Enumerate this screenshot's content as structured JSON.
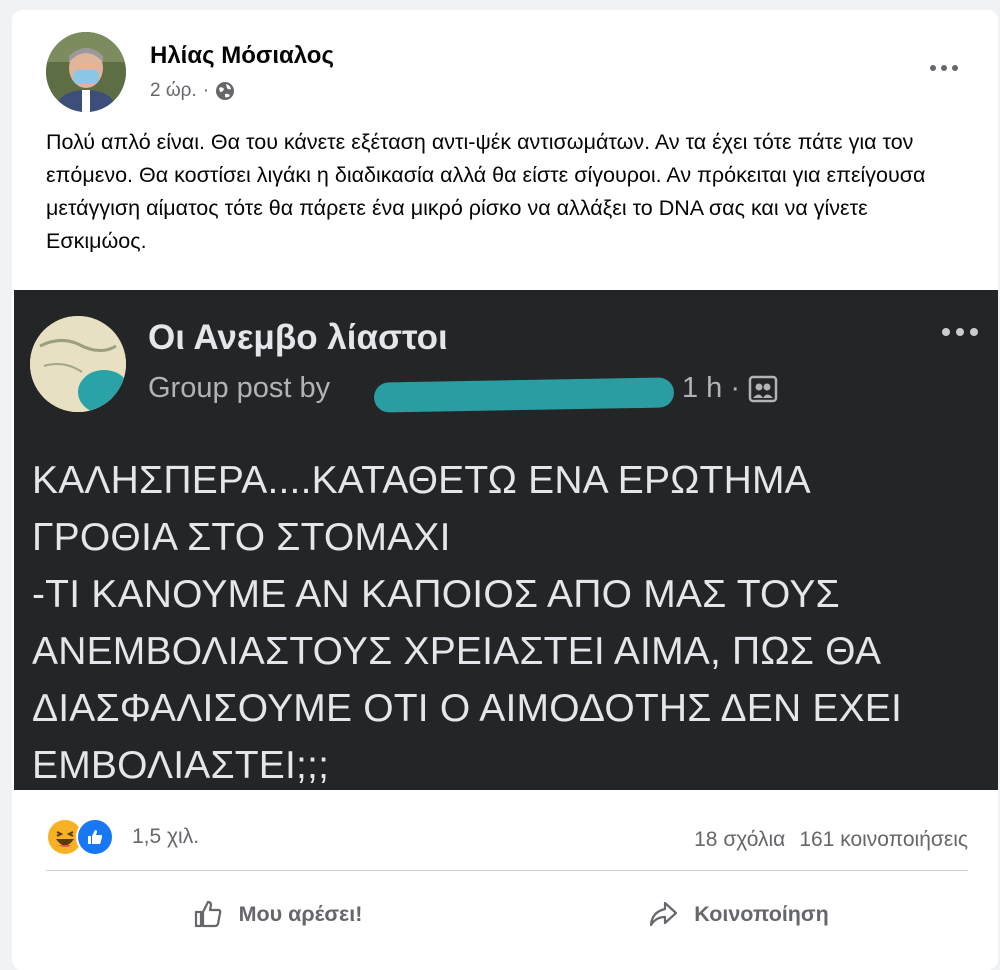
{
  "post": {
    "author": "Ηλίας Μόσιαλος",
    "time": "2 ώρ.",
    "separator": "·",
    "privacy_icon": "globe-icon",
    "more_icon": "more-options-icon",
    "text": "Πολύ απλό είναι. Θα του κάνετε εξέταση αντι-ψέκ αντισωμάτων. Αν τα έχει τότε πάτε για τον επόμενο. Θα κοστίσει λιγάκι η διαδικασία αλλά θα είστε σίγουροι. Αν πρόκειται για επείγουσα μετάγγιση αίματος τότε θα πάρετε ένα μικρό ρίσκο να αλλάξει το DNA σας και να γίνετε Εσκιμώος."
  },
  "shared": {
    "group_name": "Οι Ανεμβο λίαστοι",
    "meta_prefix": "Group post by",
    "time": "1 h ·",
    "body": "ΚΑΛΗΣΠΕΡΑ....ΚΑΤΑΘΕΤΩ ΕΝΑ ΕΡΩΤΗΜΑ\nΓΡΟΘΙΑ ΣΤΟ ΣΤΟΜΑΧΙ\n-ΤΙ ΚΑΝΟΥΜΕ ΑΝ ΚΑΠΟΙΟΣ ΑΠΟ ΜΑΣ ΤΟΥΣ\nΑΝΕΜΒΟΛΙΑΣΤΟΥΣ ΧΡΕΙΑΣΤΕΙ ΑΙΜΑ, ΠΩΣ ΘΑ\nΔΙΑΣΦΑΛΙΣΟΥΜΕ ΟΤΙ Ο ΑΙΜΟΔΟΤΗΣ ΔΕΝ ΕΧΕΙ\nΕΜΒΟΛΙΑΣΤΕΙ;;;"
  },
  "stats": {
    "reactions": "1,5 χιλ.",
    "comments": "18 σχόλια",
    "shares": "161 κοινοποιήσεις"
  },
  "actions": {
    "like": "Μου αρέσει!",
    "share": "Κοινοποίηση"
  },
  "colors": {
    "accent": "#1877f2",
    "dark_panel": "#242526",
    "redaction": "#2aa3a8"
  }
}
